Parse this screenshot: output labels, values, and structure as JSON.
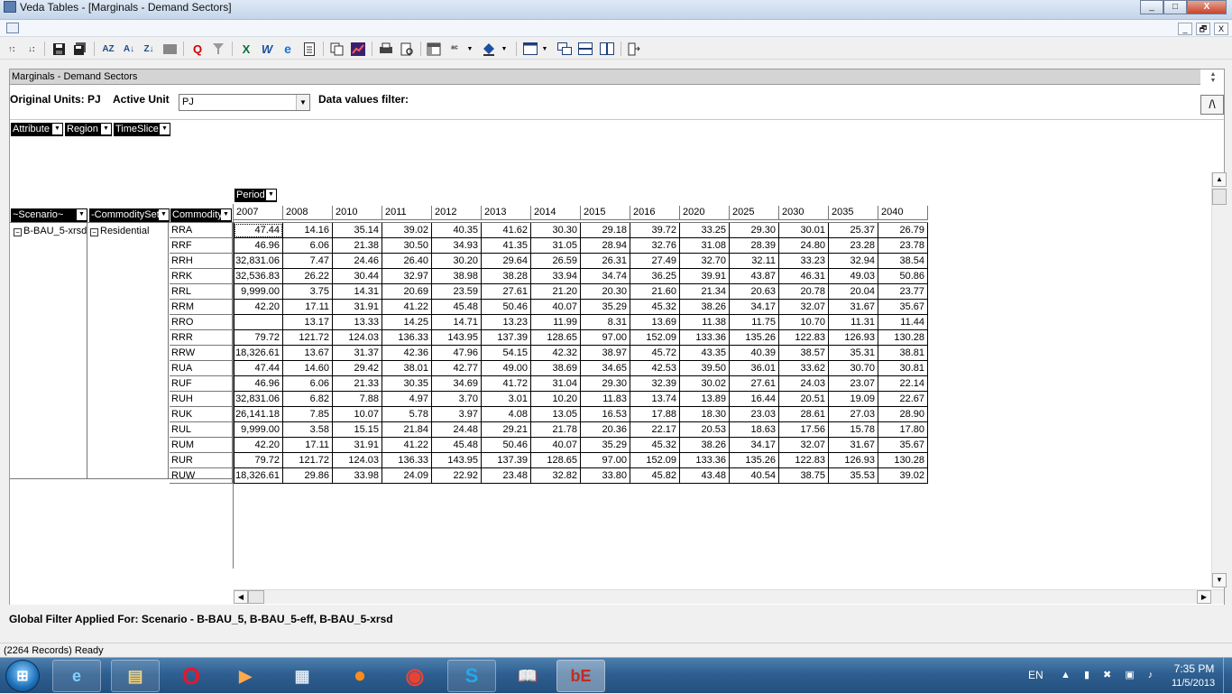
{
  "window": {
    "title": "Veda Tables - [Marginals - Demand Sectors]",
    "minimize": "_",
    "maximize": "□",
    "close": "X"
  },
  "mdi": {
    "minimize": "_",
    "restore": "🗗",
    "close": "X"
  },
  "toolbar": {
    "items": [
      "sort-asc-icon",
      "sort-desc-icon",
      "save-icon",
      "save-all-icon",
      "az-icon",
      "sort-az-icon",
      "sort-za-icon",
      "block-icon",
      "filter-clear-icon",
      "filter-icon",
      "excel-icon",
      "word-icon",
      "ie-icon",
      "note-icon",
      "copy-icon",
      "chart-icon",
      "print-icon",
      "preview-icon",
      "pivot-icon",
      "abc-icon",
      "fill-icon",
      "window-icon",
      "tile-cascade-icon",
      "tile-horizontal-icon",
      "tile-vertical-icon",
      "exit-icon"
    ]
  },
  "panel": {
    "caption": "Marginals - Demand Sectors",
    "original_units_label": "Original Units: PJ",
    "active_unit_label": "Active Unit",
    "active_unit_value": "PJ",
    "data_filter_label": "Data values filter:",
    "collapse_symbol": "/\\"
  },
  "pivot": {
    "filter_fields": [
      "Attribute",
      "Region",
      "TimeSlice"
    ],
    "column_field": "Period",
    "row_fields": [
      "~Scenario~",
      "-CommoditySet-",
      "Commodity"
    ],
    "scenario": "B-BAU_5-xrsd",
    "commodity_set": "Residential",
    "expand_symbol": "−",
    "years": [
      "2007",
      "2008",
      "2010",
      "2011",
      "2012",
      "2013",
      "2014",
      "2015",
      "2016",
      "2020",
      "2025",
      "2030",
      "2035",
      "2040"
    ],
    "rows": [
      {
        "commodity": "RRA",
        "values": [
          "47.44",
          "14.16",
          "35.14",
          "39.02",
          "40.35",
          "41.62",
          "30.30",
          "29.18",
          "39.72",
          "33.25",
          "29.30",
          "30.01",
          "25.37",
          "26.79"
        ]
      },
      {
        "commodity": "RRF",
        "values": [
          "46.96",
          "6.06",
          "21.38",
          "30.50",
          "34.93",
          "41.35",
          "31.05",
          "28.94",
          "32.76",
          "31.08",
          "28.39",
          "24.80",
          "23.28",
          "23.78"
        ]
      },
      {
        "commodity": "RRH",
        "values": [
          "32,831.06",
          "7.47",
          "24.46",
          "26.40",
          "30.20",
          "29.64",
          "26.59",
          "26.31",
          "27.49",
          "32.70",
          "32.11",
          "33.23",
          "32.94",
          "38.54"
        ]
      },
      {
        "commodity": "RRK",
        "values": [
          "32,536.83",
          "26.22",
          "30.44",
          "32.97",
          "38.98",
          "38.28",
          "33.94",
          "34.74",
          "36.25",
          "39.91",
          "43.87",
          "46.31",
          "49.03",
          "50.86"
        ]
      },
      {
        "commodity": "RRL",
        "values": [
          "9,999.00",
          "3.75",
          "14.31",
          "20.69",
          "23.59",
          "27.61",
          "21.20",
          "20.30",
          "21.60",
          "21.34",
          "20.63",
          "20.78",
          "20.04",
          "23.77"
        ]
      },
      {
        "commodity": "RRM",
        "values": [
          "42.20",
          "17.11",
          "31.91",
          "41.22",
          "45.48",
          "50.46",
          "40.07",
          "35.29",
          "45.32",
          "38.26",
          "34.17",
          "32.07",
          "31.67",
          "35.67"
        ]
      },
      {
        "commodity": "RRO",
        "values": [
          "",
          "13.17",
          "13.33",
          "14.25",
          "14.71",
          "13.23",
          "11.99",
          "8.31",
          "13.69",
          "11.38",
          "11.75",
          "10.70",
          "11.31",
          "11.44"
        ]
      },
      {
        "commodity": "RRR",
        "values": [
          "79.72",
          "121.72",
          "124.03",
          "136.33",
          "143.95",
          "137.39",
          "128.65",
          "97.00",
          "152.09",
          "133.36",
          "135.26",
          "122.83",
          "126.93",
          "130.28"
        ]
      },
      {
        "commodity": "RRW",
        "values": [
          "18,326.61",
          "13.67",
          "31.37",
          "42.36",
          "47.96",
          "54.15",
          "42.32",
          "38.97",
          "45.72",
          "43.35",
          "40.39",
          "38.57",
          "35.31",
          "38.81"
        ]
      },
      {
        "commodity": "RUA",
        "values": [
          "47.44",
          "14.60",
          "29.42",
          "38.01",
          "42.77",
          "49.00",
          "38.69",
          "34.65",
          "42.53",
          "39.50",
          "36.01",
          "33.62",
          "30.70",
          "30.81"
        ]
      },
      {
        "commodity": "RUF",
        "values": [
          "46.96",
          "6.06",
          "21.33",
          "30.35",
          "34.69",
          "41.72",
          "31.04",
          "29.30",
          "32.39",
          "30.02",
          "27.61",
          "24.03",
          "23.07",
          "22.14"
        ]
      },
      {
        "commodity": "RUH",
        "values": [
          "32,831.06",
          "6.82",
          "7.88",
          "4.97",
          "3.70",
          "3.01",
          "10.20",
          "11.83",
          "13.74",
          "13.89",
          "16.44",
          "20.51",
          "19.09",
          "22.67"
        ]
      },
      {
        "commodity": "RUK",
        "values": [
          "26,141.18",
          "7.85",
          "10.07",
          "5.78",
          "3.97",
          "4.08",
          "13.05",
          "16.53",
          "17.88",
          "18.30",
          "23.03",
          "28.61",
          "27.03",
          "28.90"
        ]
      },
      {
        "commodity": "RUL",
        "values": [
          "9,999.00",
          "3.58",
          "15.15",
          "21.84",
          "24.48",
          "29.21",
          "21.78",
          "20.36",
          "22.17",
          "20.53",
          "18.63",
          "17.56",
          "15.78",
          "17.80"
        ]
      },
      {
        "commodity": "RUM",
        "values": [
          "42.20",
          "17.11",
          "31.91",
          "41.22",
          "45.48",
          "50.46",
          "40.07",
          "35.29",
          "45.32",
          "38.26",
          "34.17",
          "32.07",
          "31.67",
          "35.67"
        ]
      },
      {
        "commodity": "RUR",
        "values": [
          "79.72",
          "121.72",
          "124.03",
          "136.33",
          "143.95",
          "137.39",
          "128.65",
          "97.00",
          "152.09",
          "133.36",
          "135.26",
          "122.83",
          "126.93",
          "130.28"
        ]
      },
      {
        "commodity": "RUW",
        "values": [
          "18,326.61",
          "29.86",
          "33.98",
          "24.09",
          "22.92",
          "23.48",
          "32.82",
          "33.80",
          "45.82",
          "43.48",
          "40.54",
          "38.75",
          "35.53",
          "39.02"
        ]
      }
    ]
  },
  "global_filter": "Global Filter Applied For: Scenario - B-BAU_5, B-BAU_5-eff, B-BAU_5-xrsd",
  "status": "(2264 Records) Ready",
  "taskbar": {
    "apps": [
      "internet-explorer-icon",
      "file-explorer-icon",
      "opera-icon",
      "media-player-icon",
      "calculator-icon",
      "firefox-icon",
      "chrome-icon",
      "skype-icon",
      "reader-icon",
      "veda-icon"
    ],
    "lang": "EN",
    "time": "7:35 PM",
    "date": "11/5/2013"
  }
}
